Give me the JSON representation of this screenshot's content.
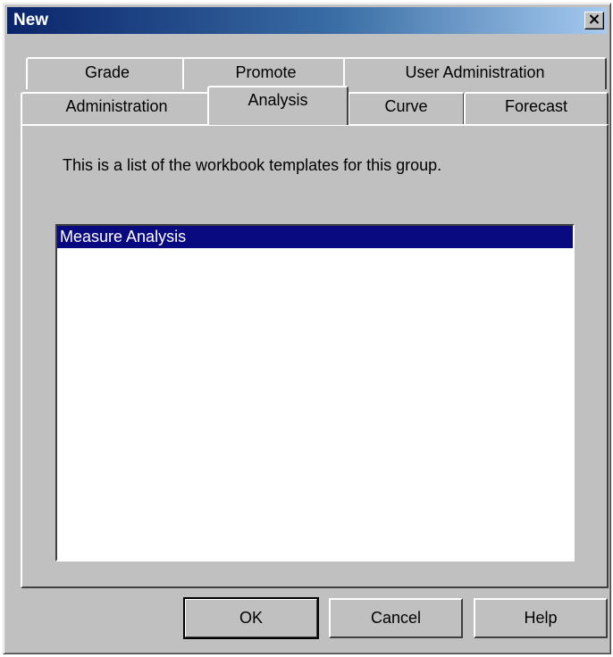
{
  "window": {
    "title": "New",
    "close_icon": "close-icon"
  },
  "tabs": {
    "back_row": [
      {
        "label": "Grade"
      },
      {
        "label": "Promote"
      },
      {
        "label": "User Administration"
      }
    ],
    "front_row": [
      {
        "label": "Administration"
      },
      {
        "label": "Analysis",
        "selected": true
      },
      {
        "label": "Curve"
      },
      {
        "label": "Forecast"
      }
    ]
  },
  "panel": {
    "description": "This is a list of the workbook templates for this group.",
    "templates": [
      "Measure Analysis"
    ],
    "selected_template": "Measure Analysis"
  },
  "buttons": {
    "ok": "OK",
    "cancel": "Cancel",
    "help": "Help"
  },
  "colors": {
    "dialog_face": "#c0c0c0",
    "title_start": "#0a246a",
    "title_end": "#a6caf0",
    "selection": "#0a0a80"
  }
}
